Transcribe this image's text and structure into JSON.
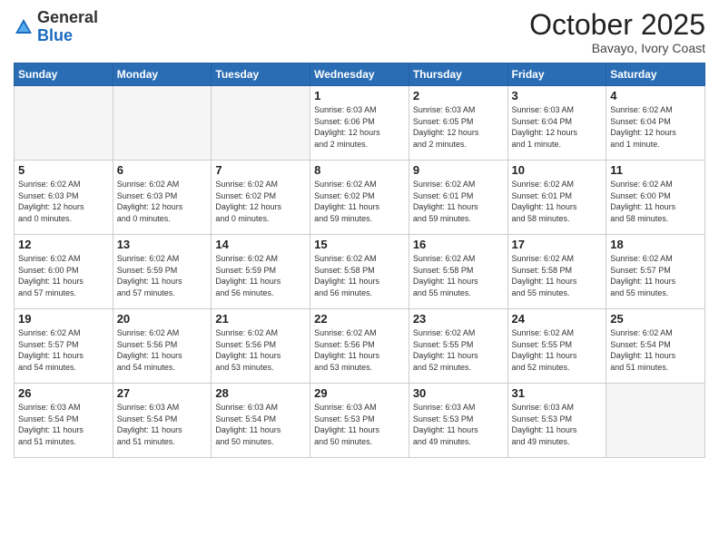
{
  "header": {
    "logo_general": "General",
    "logo_blue": "Blue",
    "month": "October 2025",
    "location": "Bavayo, Ivory Coast"
  },
  "days_of_week": [
    "Sunday",
    "Monday",
    "Tuesday",
    "Wednesday",
    "Thursday",
    "Friday",
    "Saturday"
  ],
  "weeks": [
    [
      {
        "day": "",
        "info": ""
      },
      {
        "day": "",
        "info": ""
      },
      {
        "day": "",
        "info": ""
      },
      {
        "day": "1",
        "info": "Sunrise: 6:03 AM\nSunset: 6:06 PM\nDaylight: 12 hours\nand 2 minutes."
      },
      {
        "day": "2",
        "info": "Sunrise: 6:03 AM\nSunset: 6:05 PM\nDaylight: 12 hours\nand 2 minutes."
      },
      {
        "day": "3",
        "info": "Sunrise: 6:03 AM\nSunset: 6:04 PM\nDaylight: 12 hours\nand 1 minute."
      },
      {
        "day": "4",
        "info": "Sunrise: 6:02 AM\nSunset: 6:04 PM\nDaylight: 12 hours\nand 1 minute."
      }
    ],
    [
      {
        "day": "5",
        "info": "Sunrise: 6:02 AM\nSunset: 6:03 PM\nDaylight: 12 hours\nand 0 minutes."
      },
      {
        "day": "6",
        "info": "Sunrise: 6:02 AM\nSunset: 6:03 PM\nDaylight: 12 hours\nand 0 minutes."
      },
      {
        "day": "7",
        "info": "Sunrise: 6:02 AM\nSunset: 6:02 PM\nDaylight: 12 hours\nand 0 minutes."
      },
      {
        "day": "8",
        "info": "Sunrise: 6:02 AM\nSunset: 6:02 PM\nDaylight: 11 hours\nand 59 minutes."
      },
      {
        "day": "9",
        "info": "Sunrise: 6:02 AM\nSunset: 6:01 PM\nDaylight: 11 hours\nand 59 minutes."
      },
      {
        "day": "10",
        "info": "Sunrise: 6:02 AM\nSunset: 6:01 PM\nDaylight: 11 hours\nand 58 minutes."
      },
      {
        "day": "11",
        "info": "Sunrise: 6:02 AM\nSunset: 6:00 PM\nDaylight: 11 hours\nand 58 minutes."
      }
    ],
    [
      {
        "day": "12",
        "info": "Sunrise: 6:02 AM\nSunset: 6:00 PM\nDaylight: 11 hours\nand 57 minutes."
      },
      {
        "day": "13",
        "info": "Sunrise: 6:02 AM\nSunset: 5:59 PM\nDaylight: 11 hours\nand 57 minutes."
      },
      {
        "day": "14",
        "info": "Sunrise: 6:02 AM\nSunset: 5:59 PM\nDaylight: 11 hours\nand 56 minutes."
      },
      {
        "day": "15",
        "info": "Sunrise: 6:02 AM\nSunset: 5:58 PM\nDaylight: 11 hours\nand 56 minutes."
      },
      {
        "day": "16",
        "info": "Sunrise: 6:02 AM\nSunset: 5:58 PM\nDaylight: 11 hours\nand 55 minutes."
      },
      {
        "day": "17",
        "info": "Sunrise: 6:02 AM\nSunset: 5:58 PM\nDaylight: 11 hours\nand 55 minutes."
      },
      {
        "day": "18",
        "info": "Sunrise: 6:02 AM\nSunset: 5:57 PM\nDaylight: 11 hours\nand 55 minutes."
      }
    ],
    [
      {
        "day": "19",
        "info": "Sunrise: 6:02 AM\nSunset: 5:57 PM\nDaylight: 11 hours\nand 54 minutes."
      },
      {
        "day": "20",
        "info": "Sunrise: 6:02 AM\nSunset: 5:56 PM\nDaylight: 11 hours\nand 54 minutes."
      },
      {
        "day": "21",
        "info": "Sunrise: 6:02 AM\nSunset: 5:56 PM\nDaylight: 11 hours\nand 53 minutes."
      },
      {
        "day": "22",
        "info": "Sunrise: 6:02 AM\nSunset: 5:56 PM\nDaylight: 11 hours\nand 53 minutes."
      },
      {
        "day": "23",
        "info": "Sunrise: 6:02 AM\nSunset: 5:55 PM\nDaylight: 11 hours\nand 52 minutes."
      },
      {
        "day": "24",
        "info": "Sunrise: 6:02 AM\nSunset: 5:55 PM\nDaylight: 11 hours\nand 52 minutes."
      },
      {
        "day": "25",
        "info": "Sunrise: 6:02 AM\nSunset: 5:54 PM\nDaylight: 11 hours\nand 51 minutes."
      }
    ],
    [
      {
        "day": "26",
        "info": "Sunrise: 6:03 AM\nSunset: 5:54 PM\nDaylight: 11 hours\nand 51 minutes."
      },
      {
        "day": "27",
        "info": "Sunrise: 6:03 AM\nSunset: 5:54 PM\nDaylight: 11 hours\nand 51 minutes."
      },
      {
        "day": "28",
        "info": "Sunrise: 6:03 AM\nSunset: 5:54 PM\nDaylight: 11 hours\nand 50 minutes."
      },
      {
        "day": "29",
        "info": "Sunrise: 6:03 AM\nSunset: 5:53 PM\nDaylight: 11 hours\nand 50 minutes."
      },
      {
        "day": "30",
        "info": "Sunrise: 6:03 AM\nSunset: 5:53 PM\nDaylight: 11 hours\nand 49 minutes."
      },
      {
        "day": "31",
        "info": "Sunrise: 6:03 AM\nSunset: 5:53 PM\nDaylight: 11 hours\nand 49 minutes."
      },
      {
        "day": "",
        "info": ""
      }
    ]
  ]
}
